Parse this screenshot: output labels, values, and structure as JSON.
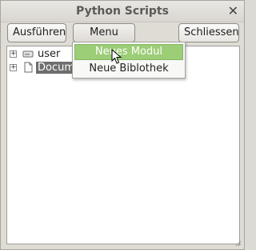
{
  "window": {
    "title": "Python Scripts",
    "close_glyph": "✕"
  },
  "toolbar": {
    "run_label": "Ausführen",
    "menu_label": "Menu",
    "close_label": "Schliessen"
  },
  "tree": {
    "rows": [
      {
        "label": "user",
        "expander": "+",
        "icon": "drive-icon"
      },
      {
        "label": "Docum",
        "expander": "+",
        "icon": "document-icon",
        "selected": true
      }
    ]
  },
  "menu": {
    "items": [
      {
        "label": "Neues Modul",
        "highlighted": true
      },
      {
        "label": "Neue Biblothek",
        "highlighted": false
      }
    ]
  },
  "colors": {
    "highlight": "#9ccd77",
    "selection": "#6e6e6e",
    "window_bg": "#dfdcd6"
  }
}
